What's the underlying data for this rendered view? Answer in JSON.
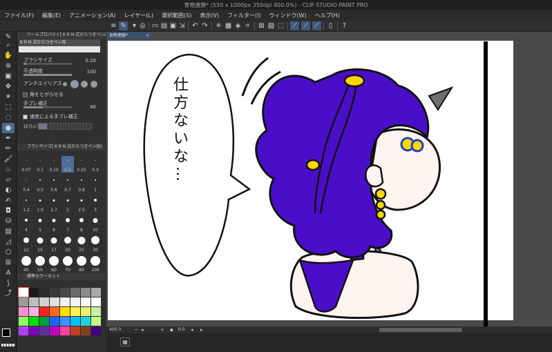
{
  "window": {
    "title": "食物連鎖* (550 x 1000px 350dpi 400.0%)  - CLIP STUDIO PAINT PRO"
  },
  "menu": [
    "ファイル(F)",
    "編集(E)",
    "アニメーション(A)",
    "レイヤー(L)",
    "選択範囲(S)",
    "表示(V)",
    "フィルター(I)",
    "ウィンドウ(W)",
    "ヘルプ(H)"
  ],
  "tool_property": {
    "header": "ツールプロパティ[ K R N 式だらつきペン改]",
    "brush_name": "K R N 式だらつきペン改",
    "brush_size_label": "ブラシサイズ",
    "brush_size_value": "0.20",
    "brush_size_fraction": 0.05,
    "opacity_label": "不透明度",
    "opacity_value": "100",
    "opacity_fraction": 1.0,
    "antialias_label": "アンチエイリアス",
    "corner_label": "角をとがらせる",
    "stabilization_label": "手ブレ補正",
    "stabilization_value": "40",
    "stabilization_fraction": 0.4,
    "speed_label": "速度による手ブレ補正",
    "blur_label": "はらい"
  },
  "brush_size": {
    "header": "ブラシサイズ[ K R N 式だらつきペン改]",
    "sizes": [
      "0.07",
      "0.1",
      "0.15",
      "0.2",
      "0.25",
      "0.3",
      "0.4",
      "0.5",
      "0.6",
      "0.7",
      "0.8",
      "1",
      "1.2",
      "1.5",
      "1.7",
      "2",
      "2.5",
      "3",
      "4",
      "5",
      "6",
      "7",
      "8",
      "10",
      "12",
      "15",
      "17",
      "20",
      "25",
      "30",
      "40",
      "50",
      "60",
      "70",
      "80",
      "100"
    ],
    "selected": "0.2"
  },
  "color_set": {
    "header": "標準カラーセット",
    "swatches": [
      "#ffffff",
      "#1a1a1a",
      "#2a2a2a",
      "#3a3a3a",
      "#4a4a4a",
      "#6a6a6a",
      "#8a8a8a",
      "#aaaaaa",
      "#9a9a9a",
      "#bfbfbf",
      "#d0d0d0",
      "#e0e0e0",
      "#efefef",
      "#f4f4f4",
      "#f8f8f8",
      "#ffffff",
      "#ff8fd0",
      "#ffb0e0",
      "#ff2020",
      "#ff6a1a",
      "#ffe000",
      "#fff04a",
      "#e8f070",
      "#c8f0a0",
      "#90ff60",
      "#00e000",
      "#00a040",
      "#2060ff",
      "#4090ff",
      "#00c0ff",
      "#20d0e0",
      "#c0ff80",
      "#b040ff",
      "#8000c0",
      "#6030a0",
      "#c000c0",
      "#ff40a0",
      "#c04020",
      "#804020",
      "#400080"
    ]
  },
  "document": {
    "tab_label": "食物連鎖*",
    "zoom": "400.0",
    "angle": "0.0"
  },
  "speech_bubble": {
    "lines": [
      "仕",
      "方",
      "な",
      "い",
      "な",
      "…"
    ]
  },
  "colors": {
    "hair": "#4a0ec8",
    "skin": "#fff4f0",
    "accessory": "#ffd800",
    "eye_ring": "#1e3ec8",
    "selected_tool": "#4a6a90"
  }
}
